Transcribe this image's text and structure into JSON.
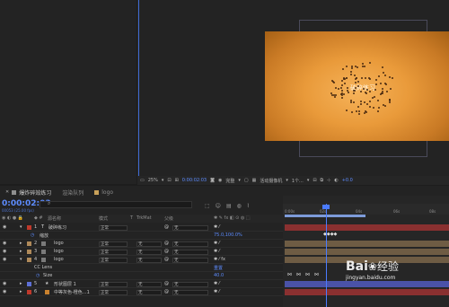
{
  "viewer": {
    "comp_title": "破碎练习",
    "toolbar": {
      "zoom": "25%",
      "timecode": "0:00:02:03",
      "quality": "完整",
      "camera": "活动摄像机",
      "views": "1个...",
      "exposure": "+0.0"
    }
  },
  "timeline": {
    "tabs": [
      {
        "label": "爆炸碎效练习",
        "color": "#8f8f8f"
      },
      {
        "label": "渲染队列",
        "color": "#8f8f8f"
      },
      {
        "label": "logo",
        "color": "#c9a15a"
      }
    ],
    "timecode": "0:00:02:03",
    "fps": "00053 (25.00 fps)",
    "search_placeholder": "",
    "headers": {
      "name": "源名称",
      "mode": "模式",
      "t": "T",
      "trkmat": "TrkMat",
      "parent": "父级"
    },
    "ruler_ticks": [
      "0:00s",
      "02s",
      "04s",
      "06s",
      "08s"
    ],
    "layers": [
      {
        "num": "1",
        "type": "T",
        "name": "破碎练习",
        "mode": "正常",
        "trk": "",
        "parent": "无",
        "color": "#c0392b"
      },
      {
        "num": "",
        "type": "",
        "name": "缩放",
        "value": "75.0,100.0%",
        "sub": true
      },
      {
        "num": "2",
        "type": "",
        "name": "logo",
        "mode": "正常",
        "trk": "无",
        "parent": "无",
        "color": "#b08a5a"
      },
      {
        "num": "3",
        "type": "",
        "name": "logo",
        "mode": "正常",
        "trk": "无",
        "parent": "无",
        "color": "#b08a5a"
      },
      {
        "num": "4",
        "type": "",
        "name": "logo",
        "mode": "正常",
        "trk": "无",
        "parent": "无",
        "color": "#b08a5a"
      },
      {
        "num": "",
        "type": "",
        "name": "CC Lens",
        "value": "重置",
        "sub": true
      },
      {
        "num": "",
        "type": "",
        "name": "Size",
        "value": "40.0",
        "sub": true
      },
      {
        "num": "5",
        "type": "",
        "name": "形状图层 1",
        "mode": "正常",
        "trk": "无",
        "parent": "无",
        "color": "#5d6fd6"
      },
      {
        "num": "6",
        "type": "",
        "name": "中等灰色-橙色...1",
        "mode": "正常",
        "trk": "无",
        "parent": "无",
        "color": "#c0392b"
      }
    ]
  },
  "watermark": {
    "brand": "Bai",
    "brand2": "经验",
    "url": "jingyan.baidu.com"
  }
}
